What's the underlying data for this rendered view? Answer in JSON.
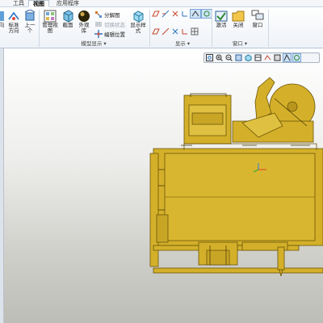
{
  "tabs": [
    {
      "label": "工具",
      "active": false
    },
    {
      "label": "视图",
      "active": true
    },
    {
      "label": "应用程序",
      "active": false
    }
  ],
  "ribbon": {
    "partial_left_label": "向",
    "standard_orientation_label": "标准\n方向",
    "previous_label": "上一\n个",
    "manage_views_label": "管理视\n图",
    "section_label": "截面",
    "appearance_label": "外观\n库",
    "exploded_view_label": "分解图",
    "toggle_status_label": "切换状态",
    "edit_position_label": "编辑位置",
    "display_style_label": "显示样\n式",
    "activate_label": "激活",
    "close_label": "关闭",
    "window_label": "窗口",
    "groups": {
      "model_display": "模型显示",
      "display": "显示",
      "window": "窗口"
    }
  },
  "colors": {
    "model": "#d4b02a",
    "model_dark": "#7a6410",
    "model_line": "#3f3405"
  },
  "icons": {
    "view_toolbar": [
      "zoom-fit-icon",
      "zoom-in-icon",
      "zoom-out-icon",
      "repaint-icon",
      "shading-icon",
      "saved-views-icon",
      "annotation-icon",
      "datum-display-icon",
      "spin-center-icon",
      "view-manager-icon"
    ]
  }
}
